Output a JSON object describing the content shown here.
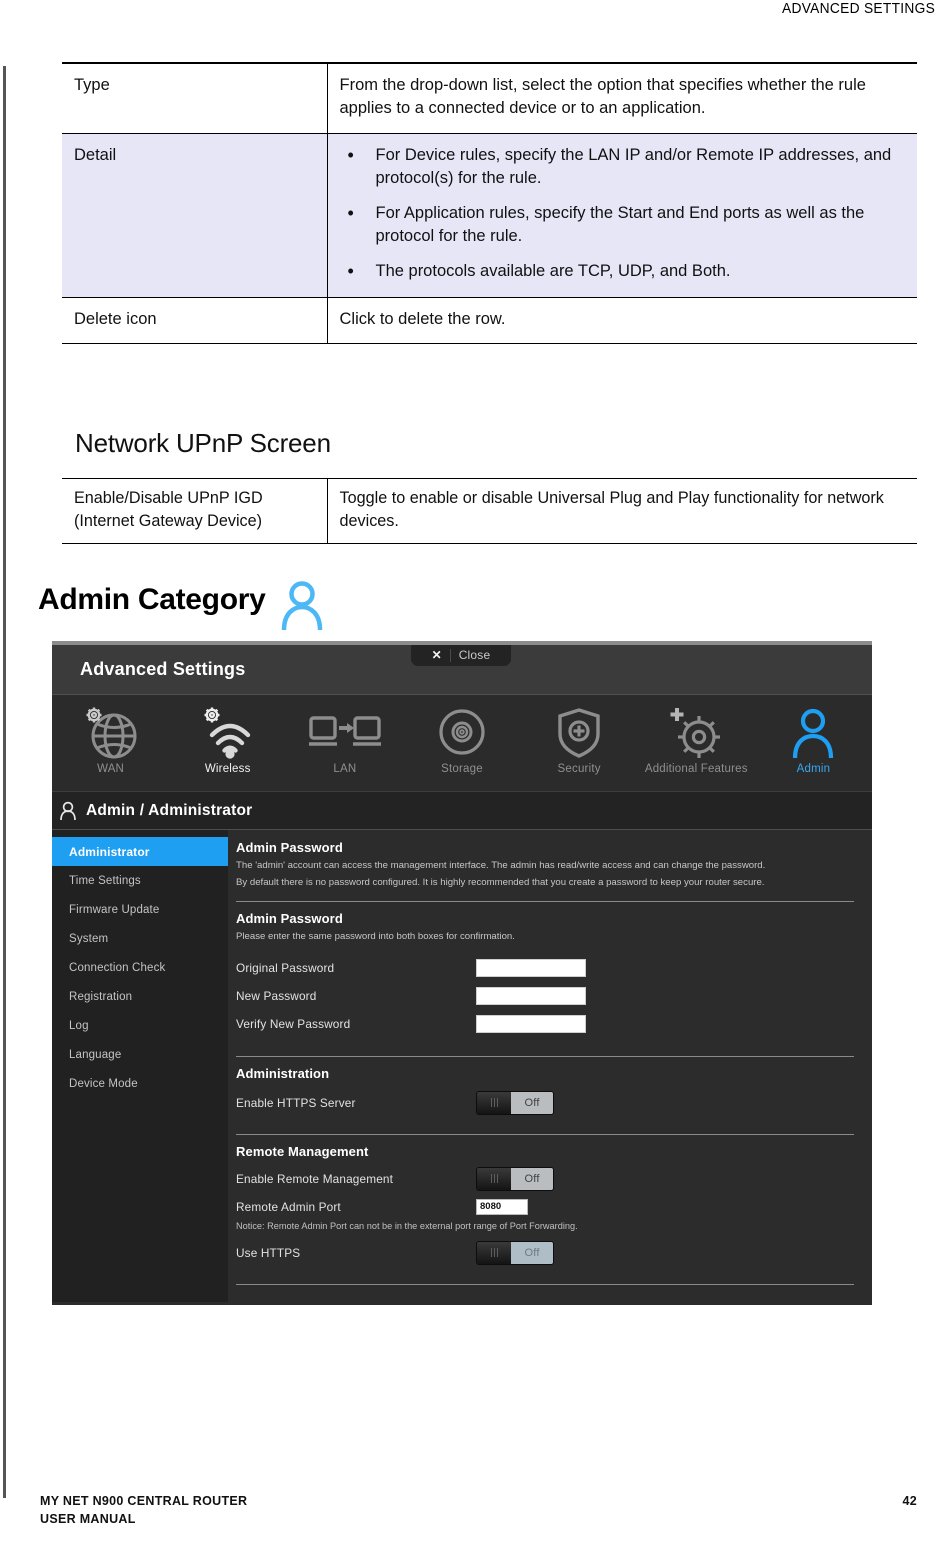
{
  "page": {
    "header_text": "ADVANCED SETTINGS",
    "footer_line1": "MY NET N900 CENTRAL ROUTER",
    "footer_line2": "USER MANUAL",
    "page_number": "42"
  },
  "rules_table": {
    "rows": [
      {
        "label": "Type",
        "description": "From the drop-down list, select the option that specifies whether the rule applies to a connected device or to an application."
      },
      {
        "label": "Detail",
        "bullets": [
          "For Device rules, specify the LAN IP and/or Remote IP addresses, and protocol(s) for the rule.",
          "For Application rules, specify the Start and End ports as well as the protocol for the rule.",
          "The protocols available are TCP, UDP, and Both."
        ]
      },
      {
        "label": "Delete icon",
        "description": "Click to delete the row."
      }
    ]
  },
  "upnp_section": {
    "heading": "Network UPnP Screen",
    "row": {
      "label": "Enable/Disable UPnP IGD (Internet Gateway Device)",
      "description": "Toggle to enable or disable Universal Plug and Play functionality for network devices."
    }
  },
  "admin_category": {
    "heading": "Admin Category",
    "icon": "person-icon"
  },
  "router_ui": {
    "window_title": "Advanced Settings",
    "close_button": {
      "label": "Close",
      "icon": "close-x-icon"
    },
    "nav": [
      {
        "label": "WAN",
        "icon": "globe-gear-icon",
        "state": "normal"
      },
      {
        "label": "Wireless",
        "icon": "wifi-gear-icon",
        "state": "bright"
      },
      {
        "label": "LAN",
        "icon": "lan-devices-icon",
        "state": "normal"
      },
      {
        "label": "Storage",
        "icon": "disc-icon",
        "state": "normal"
      },
      {
        "label": "Security",
        "icon": "shield-plus-icon",
        "state": "normal"
      },
      {
        "label": "Additional Features",
        "icon": "gear-plus-icon",
        "state": "normal"
      },
      {
        "label": "Admin",
        "icon": "person-icon",
        "state": "active"
      }
    ],
    "breadcrumb": "Admin / Administrator",
    "sidebar": [
      {
        "label": "Administrator",
        "active": true
      },
      {
        "label": "Time Settings",
        "active": false
      },
      {
        "label": "Firmware Update",
        "active": false
      },
      {
        "label": "System",
        "active": false
      },
      {
        "label": "Connection Check",
        "active": false
      },
      {
        "label": "Registration",
        "active": false
      },
      {
        "label": "Log",
        "active": false
      },
      {
        "label": "Language",
        "active": false
      },
      {
        "label": "Device Mode",
        "active": false
      }
    ],
    "admin_password_intro": {
      "heading": "Admin Password",
      "line1": "The 'admin' account can access the management interface. The admin has read/write access and can change the password.",
      "line2": "By default there is no password configured. It is highly recommended that you create a password to keep your router secure."
    },
    "admin_password_form": {
      "heading": "Admin Password",
      "subtext": "Please enter the same password into both boxes for confirmation.",
      "fields": [
        {
          "label": "Original Password",
          "value": ""
        },
        {
          "label": "New Password",
          "value": ""
        },
        {
          "label": "Verify New Password",
          "value": ""
        }
      ]
    },
    "administration": {
      "heading": "Administration",
      "https_server": {
        "label": "Enable HTTPS Server",
        "state": "Off"
      }
    },
    "remote_management": {
      "heading": "Remote Management",
      "enable": {
        "label": "Enable Remote Management",
        "state": "Off"
      },
      "port": {
        "label": "Remote Admin Port",
        "value": "8080"
      },
      "notice": "Notice: Remote Admin Port can not be in the external port range of Port Forwarding.",
      "use_https": {
        "label": "Use HTTPS",
        "state": "Off"
      }
    },
    "colors": {
      "accent_blue": "#1e9ff2",
      "panel_dark": "#2c2c2c",
      "sidebar_dark": "#212121",
      "titlebar": "#3b3b3b"
    }
  }
}
